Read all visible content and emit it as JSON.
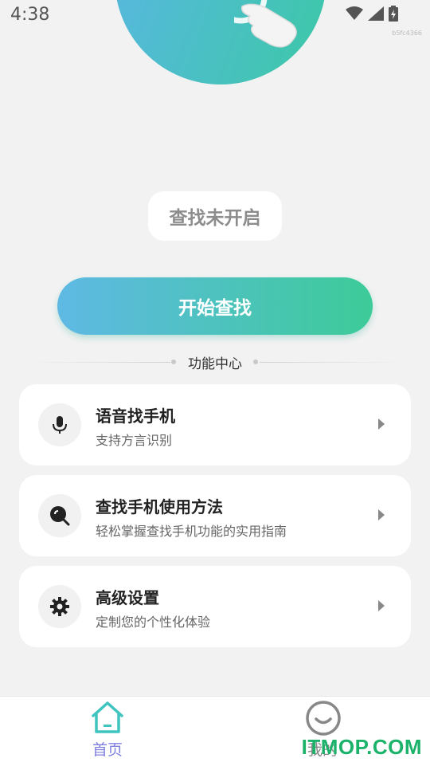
{
  "status_bar": {
    "time": "4:38",
    "small_id": "b5fc4366"
  },
  "status": {
    "text": "查找未开启"
  },
  "start_button": {
    "label": "开始查找"
  },
  "section": {
    "title": "功能中心"
  },
  "cards": [
    {
      "title": "语音找手机",
      "subtitle": "支持方言识别",
      "icon": "microphone-icon"
    },
    {
      "title": "查找手机使用方法",
      "subtitle": "轻松掌握查找手机功能的实用指南",
      "icon": "search-icon"
    },
    {
      "title": "高级设置",
      "subtitle": "定制您的个性化体验",
      "icon": "gear-icon"
    }
  ],
  "bottom_nav": {
    "home_label": "首页",
    "mine_label": "我的"
  },
  "watermark": "ITMOP.COM",
  "colors": {
    "accent_start": "#5bb6e6",
    "accent_end": "#3cc8a6",
    "nav_active": "#7f7fe0",
    "watermark": "#1bb36a"
  }
}
